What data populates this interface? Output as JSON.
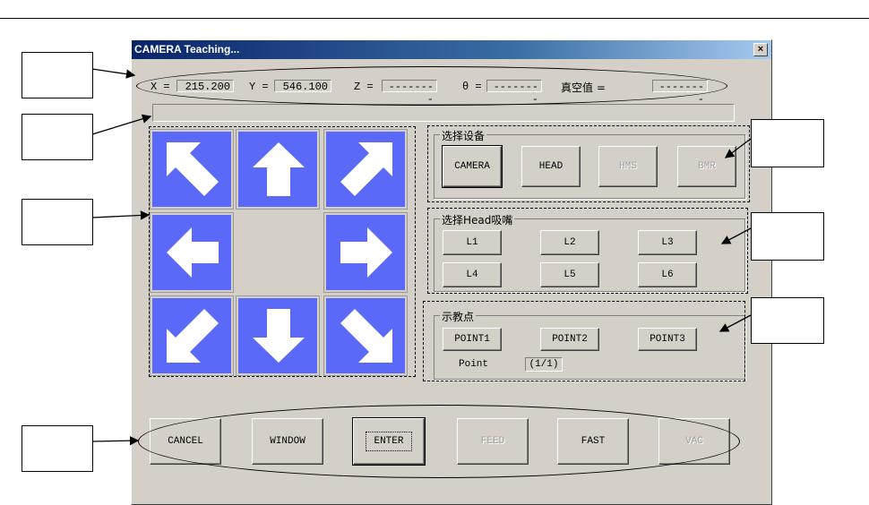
{
  "window": {
    "title": "CAMERA Teaching...",
    "close": "×"
  },
  "coords": {
    "x_label": "X =",
    "x_value": "215.200",
    "y_label": "Y =",
    "y_value": "546.100",
    "z_label": "Z =",
    "z_value": "--------",
    "t_label": "θ =",
    "t_value": "--------",
    "vac_label": "真空值 =",
    "vac_value": "--------"
  },
  "groups": {
    "device": {
      "title": "选择设备",
      "buttons": [
        "CAMERA",
        "HEAD",
        "HMS",
        "BMR"
      ]
    },
    "head": {
      "title": "选择Head吸嘴",
      "buttons": [
        "L1",
        "L2",
        "L3",
        "L4",
        "L5",
        "L6"
      ]
    },
    "teach": {
      "title": "示教点",
      "buttons": [
        "POINT1",
        "POINT2",
        "POINT3"
      ],
      "point_label": "Point",
      "point_value": "(1/1)"
    }
  },
  "bottom": {
    "buttons": [
      "CANCEL",
      "WINDOW",
      "ENTER",
      "FEED",
      "FAST",
      "VAC"
    ]
  },
  "colors": {
    "jog": "#5b69f8",
    "face": "#d4d0c8",
    "title_start": "#0a246a"
  },
  "jog_icons": [
    "arrow-up-left-icon",
    "arrow-up-icon",
    "arrow-up-right-icon",
    "arrow-left-icon",
    "arrow-right-icon",
    "arrow-down-left-icon",
    "arrow-down-icon",
    "arrow-down-right-icon"
  ]
}
